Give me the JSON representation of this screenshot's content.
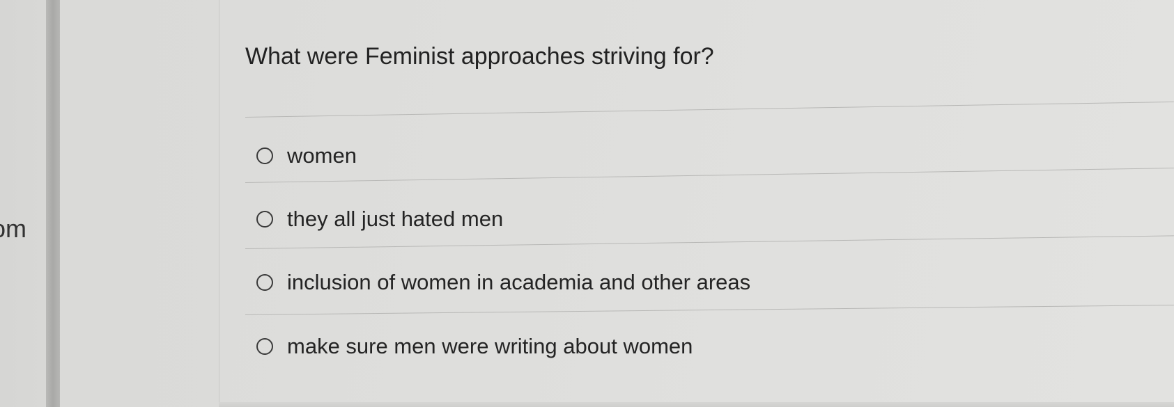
{
  "left_fragment": "om",
  "question": {
    "text": "What were Feminist approaches striving for?"
  },
  "options": [
    {
      "label": "women",
      "selected": false
    },
    {
      "label": "they all just hated men",
      "selected": false
    },
    {
      "label": "inclusion of women in academia and other areas",
      "selected": false
    },
    {
      "label": "make sure men were writing about women",
      "selected": false
    }
  ]
}
